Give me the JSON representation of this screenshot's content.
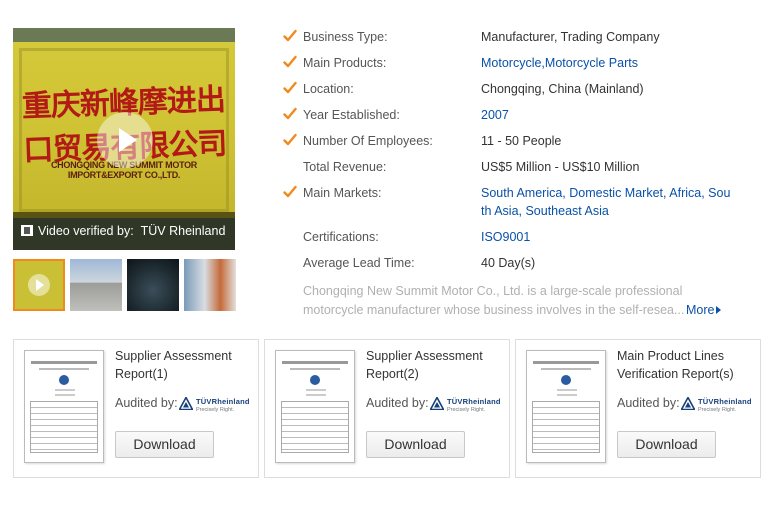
{
  "video": {
    "banner_cn": "重庆新峰摩进出口贸易有限公司",
    "banner_en": "CHONGQING NEW SUMMIT MOTOR IMPORT&EXPORT CO.,LTD.",
    "caption_prefix": "Video verified by:",
    "caption_verifier": "TÜV Rheinland",
    "thumbnails": [
      "company-sign-video",
      "factory-building",
      "motorcycle-display",
      "trade-show-booth"
    ]
  },
  "info": {
    "rows": [
      {
        "label": "Business Type:",
        "value": "Manufacturer, Trading Company",
        "checked": true,
        "link": false
      },
      {
        "label": "Main Products:",
        "value": "Motorcycle,Motorcycle Parts",
        "checked": true,
        "link": true
      },
      {
        "label": "Location:",
        "value": "Chongqing, China (Mainland)",
        "checked": true,
        "link": false
      },
      {
        "label": "Year Established:",
        "value": "2007",
        "checked": true,
        "link": true
      },
      {
        "label": "Number Of Employees:",
        "value": "11 - 50 People",
        "checked": true,
        "link": false
      },
      {
        "label": "Total Revenue:",
        "value": "US$5 Million - US$10 Million",
        "checked": false,
        "link": false
      },
      {
        "label": "Main Markets:",
        "value": "South America, Domestic Market, Africa, South Asia, Southeast Asia",
        "checked": true,
        "link": true
      },
      {
        "label": "Certifications:",
        "value": "ISO9001",
        "checked": false,
        "link": true
      },
      {
        "label": "Average Lead Time:",
        "value": "40 Day(s)",
        "checked": false,
        "link": false
      }
    ],
    "description": "Chongqing New Summit Motor Co., Ltd. is a large-scale professional motorcycle manufacturer whose business involves in the self-resea...",
    "more_label": "More"
  },
  "reports": [
    {
      "title": "Supplier Assessment Report(1)",
      "audited_label": "Audited by:",
      "auditor": "TÜVRheinland",
      "auditor_tagline": "Precisely Right.",
      "button": "Download"
    },
    {
      "title": "Supplier Assessment Report(2)",
      "audited_label": "Audited by:",
      "auditor": "TÜVRheinland",
      "auditor_tagline": "Precisely Right.",
      "button": "Download"
    },
    {
      "title": "Main Product Lines Verification Report(s)",
      "audited_label": "Audited by:",
      "auditor": "TÜVRheinland",
      "auditor_tagline": "Precisely Right.",
      "button": "Download"
    }
  ],
  "colors": {
    "check": "#f08a1c",
    "link": "#0a51a8",
    "muted": "#b0b0b0",
    "tuv_blue": "#16407a"
  },
  "icons": {
    "check": "check-icon",
    "play": "play-icon",
    "film": "video-icon",
    "more": "triangle-right-icon"
  }
}
